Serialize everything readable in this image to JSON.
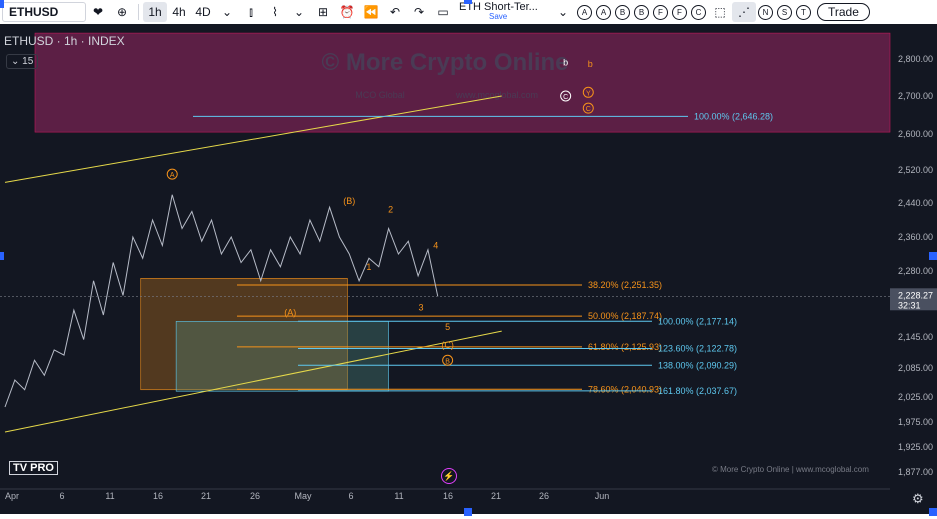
{
  "toolbar": {
    "symbol": "ETHUSD",
    "intervals": [
      "1h",
      "4h",
      "4D"
    ],
    "layout_name": "ETH Short-Ter...",
    "layout_save": "Save",
    "circle_tools": [
      "A",
      "A",
      "B",
      "B",
      "F",
      "F",
      "C",
      "N",
      "S",
      "T"
    ],
    "trade_label": "Trade",
    "icons": [
      "heart-icon",
      "plus-icon",
      "chevron-down-icon",
      "candles-icon",
      "indicators-icon",
      "templates-icon",
      "alert-icon",
      "replay-icon",
      "undo-icon",
      "redo-icon",
      "layout-icon"
    ]
  },
  "legend": {
    "title": "ETHUSD · 1h · INDEX",
    "indicator_count": "15"
  },
  "watermark": {
    "text": "© More Crypto Online",
    "subtext": "MCO Global",
    "url": "www.mcoglobal.com"
  },
  "logo": "TV PRO",
  "footer_credit": "© More Crypto Online  |  www.mcoglobal.com",
  "colors": {
    "background": "#131722",
    "orange": "#f7931a",
    "cyan": "#5ec8ef",
    "yellow": "#e6d94a",
    "magenta_zone": "#5c1f45",
    "price_tag": "#4a5060"
  },
  "chart_data": {
    "type": "candlestick",
    "title": "ETHUSD · 1h · INDEX",
    "x_ticks": [
      "Apr",
      "6",
      "11",
      "16",
      "21",
      "26",
      "May",
      "6",
      "11",
      "16",
      "21",
      "26",
      "Jun"
    ],
    "y_ticks": [
      "2,800.00",
      "2,700.00",
      "2,600.00",
      "2,520.00",
      "2,440.00",
      "2,360.00",
      "2,280.00",
      "2,145.00",
      "2,085.00",
      "2,025.00",
      "1,975.00",
      "1,925.00",
      "1,877.00"
    ],
    "current_price": "2,228.27",
    "countdown": "32:31",
    "price_path": [
      [
        0,
        2005
      ],
      [
        1,
        2060
      ],
      [
        2,
        2040
      ],
      [
        3,
        2100
      ],
      [
        4,
        2070
      ],
      [
        5,
        2120
      ],
      [
        6,
        2110
      ],
      [
        7,
        2200
      ],
      [
        8,
        2140
      ],
      [
        9,
        2260
      ],
      [
        10,
        2190
      ],
      [
        11,
        2300
      ],
      [
        12,
        2230
      ],
      [
        13,
        2360
      ],
      [
        14,
        2310
      ],
      [
        15,
        2400
      ],
      [
        16,
        2340
      ],
      [
        17,
        2460
      ],
      [
        18,
        2380
      ],
      [
        19,
        2420
      ],
      [
        20,
        2350
      ],
      [
        21,
        2400
      ],
      [
        22,
        2320
      ],
      [
        23,
        2360
      ],
      [
        24,
        2300
      ],
      [
        25,
        2330
      ],
      [
        26,
        2260
      ],
      [
        27,
        2330
      ],
      [
        28,
        2290
      ],
      [
        29,
        2360
      ],
      [
        30,
        2320
      ],
      [
        31,
        2400
      ],
      [
        32,
        2350
      ],
      [
        33,
        2430
      ],
      [
        34,
        2360
      ],
      [
        35,
        2320
      ],
      [
        36,
        2260
      ],
      [
        37,
        2310
      ],
      [
        38,
        2290
      ],
      [
        39,
        2380
      ],
      [
        40,
        2320
      ],
      [
        41,
        2350
      ],
      [
        42,
        2270
      ],
      [
        43,
        2330
      ],
      [
        44,
        2228
      ]
    ],
    "zones": [
      {
        "label": "",
        "color": "magenta",
        "y_top": 2870,
        "y_bottom": 2605,
        "x_from": 0,
        "x_to": 100
      },
      {
        "label": "",
        "color": "orange",
        "y_top": 2265,
        "y_bottom": 2040,
        "x_from": 23,
        "x_to": 58
      },
      {
        "label": "",
        "color": "teal",
        "y_top": 2177,
        "y_bottom": 2037,
        "x_from": 29,
        "x_to": 65
      }
    ],
    "levels": [
      {
        "label": "100.00% (2,646.28)",
        "value": 2646.28,
        "color": "cyan"
      },
      {
        "label": "38.20% (2,251.35)",
        "value": 2251.35,
        "color": "orange"
      },
      {
        "label": "50.00% (2,187.74)",
        "value": 2187.74,
        "color": "orange"
      },
      {
        "label": "100.00% (2,177.14)",
        "value": 2177.14,
        "color": "cyan"
      },
      {
        "label": "61.80% (2,125.93)",
        "value": 2125.93,
        "color": "orange"
      },
      {
        "label": "123.60% (2,122.78)",
        "value": 2122.78,
        "color": "cyan"
      },
      {
        "label": "138.00% (2,090.29)",
        "value": 2090.29,
        "color": "cyan"
      },
      {
        "label": "78.60% (2,040.93)",
        "value": 2040.93,
        "color": "orange"
      },
      {
        "label": "161.80% (2,037.67)",
        "value": 2037.67,
        "color": "cyan"
      }
    ],
    "wave_labels": [
      {
        "text": "A",
        "style": "circled",
        "color": "orange",
        "x": 17,
        "y": 2510
      },
      {
        "text": "B",
        "style": "paren",
        "color": "orange",
        "x": 35,
        "y": 2445
      },
      {
        "text": "A",
        "style": "paren",
        "color": "orange",
        "x": 29,
        "y": 2195
      },
      {
        "text": "1",
        "style": "plain",
        "color": "orange",
        "x": 37,
        "y": 2290
      },
      {
        "text": "2",
        "style": "plain",
        "color": "orange",
        "x": 39.2,
        "y": 2425
      },
      {
        "text": "3",
        "style": "plain",
        "color": "orange",
        "x": 42.3,
        "y": 2205
      },
      {
        "text": "4",
        "style": "plain",
        "color": "orange",
        "x": 43.8,
        "y": 2340
      },
      {
        "text": "5",
        "style": "plain",
        "color": "orange",
        "x": 45,
        "y": 2165
      },
      {
        "text": "C",
        "style": "paren",
        "color": "orange",
        "x": 45,
        "y": 2130
      },
      {
        "text": "B",
        "style": "circled",
        "color": "orange",
        "x": 45,
        "y": 2100
      },
      {
        "text": "b",
        "style": "plain",
        "color": "white",
        "x": 57,
        "y": 2790
      },
      {
        "text": "b",
        "style": "plain",
        "color": "orange",
        "x": 59.5,
        "y": 2787
      },
      {
        "text": "Y",
        "style": "circled",
        "color": "orange",
        "x": 59.3,
        "y": 2710
      },
      {
        "text": "C",
        "style": "circled",
        "color": "white",
        "x": 57,
        "y": 2700
      },
      {
        "text": "C",
        "style": "circled",
        "color": "orange",
        "x": 59.3,
        "y": 2668
      }
    ],
    "trendlines": [
      {
        "color": "yellow",
        "from": [
          0,
          2490
        ],
        "to": [
          50.5,
          2700
        ]
      },
      {
        "color": "yellow",
        "from": [
          0,
          1955
        ],
        "to": [
          50.5,
          2157
        ]
      }
    ]
  }
}
